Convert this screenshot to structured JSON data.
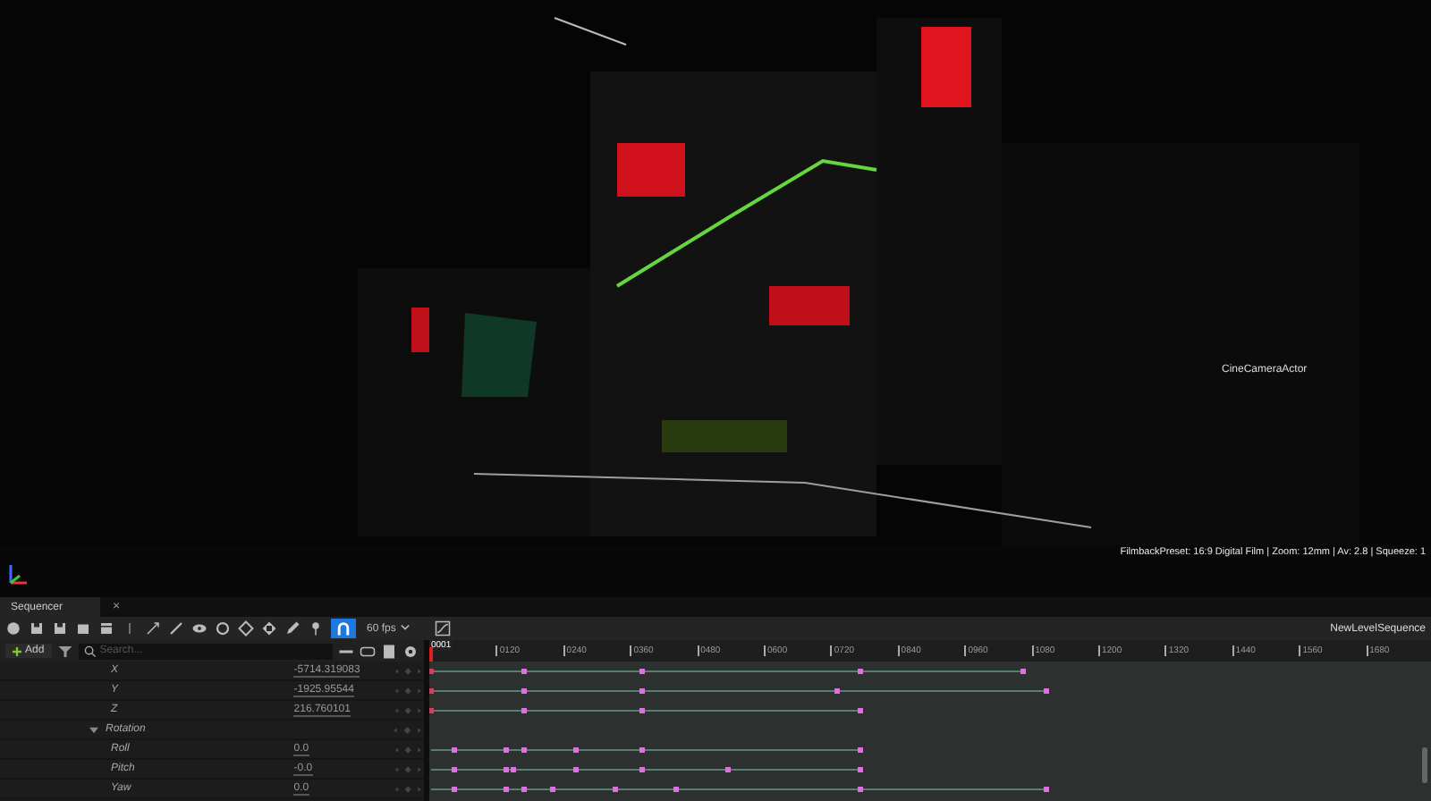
{
  "viewport": {
    "actor_label": "CineCameraActor",
    "filmback_info": "FilmbackPreset: 16:9 Digital Film | Zoom: 12mm | Av: 2.8 | Squeeze: 1"
  },
  "sequencer_tab": {
    "title": "Sequencer",
    "close": "×"
  },
  "toolbar": {
    "snap": {
      "on": true
    },
    "frame_rate": "60 fps",
    "sequence_name": "NewLevelSequence"
  },
  "outliner": {
    "add_label": "Add",
    "search": {
      "placeholder": "Search..."
    }
  },
  "timeline": {
    "playhead": "0001",
    "ticks": [
      "0120",
      "0240",
      "0360",
      "0480",
      "0600",
      "0720",
      "0840",
      "0960",
      "1080",
      "1200",
      "1320",
      "1440",
      "1560",
      "1680"
    ]
  },
  "tracks": [
    {
      "label": "X",
      "value": "-5714.319083"
    },
    {
      "label": "Y",
      "value": "-1925.95544"
    },
    {
      "label": "Z",
      "value": "216.760101"
    },
    {
      "label": "Rotation",
      "expanded": true,
      "children": [
        {
          "label": "Roll",
          "value": "0.0"
        },
        {
          "label": "Pitch",
          "value": "-0.0"
        },
        {
          "label": "Yaw",
          "value": "0.0"
        }
      ]
    }
  ]
}
